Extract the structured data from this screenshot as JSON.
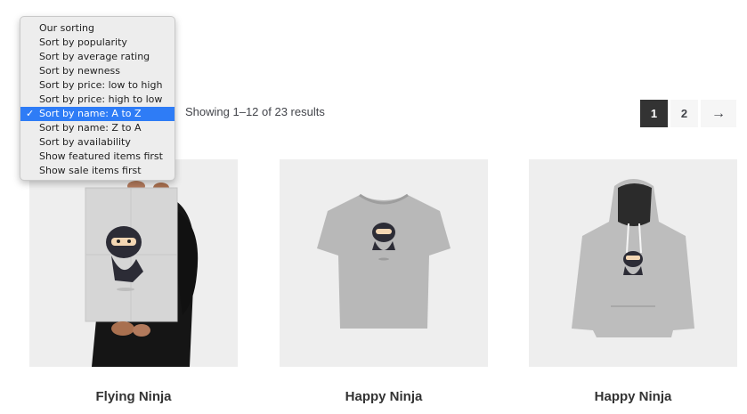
{
  "sorting": {
    "options": [
      "Our sorting",
      "Sort by popularity",
      "Sort by average rating",
      "Sort by newness",
      "Sort by price: low to high",
      "Sort by price: high to low",
      "Sort by name: A to Z",
      "Sort by name: Z to A",
      "Sort by availability",
      "Show featured items first",
      "Show sale items first"
    ],
    "selected": "Sort by name: A to Z",
    "check_icon": "checkmark-icon",
    "highlight_color": "#2e7cf6"
  },
  "result_count": "Showing 1–12 of 23 results",
  "pagination": {
    "pages": [
      "1",
      "2"
    ],
    "current": "1",
    "next": "→"
  },
  "products": [
    {
      "title": "Flying Ninja",
      "image": "ninja-poster-image"
    },
    {
      "title": "Happy Ninja",
      "image": "ninja-tshirt-image"
    },
    {
      "title": "Happy Ninja",
      "image": "ninja-hoodie-image"
    }
  ]
}
